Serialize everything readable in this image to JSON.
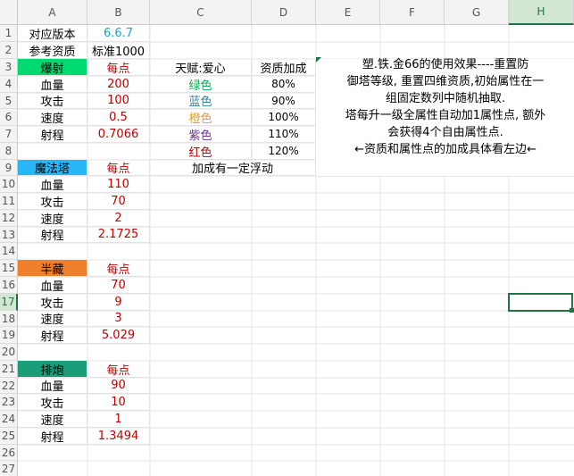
{
  "columns": [
    "A",
    "B",
    "C",
    "D",
    "E",
    "F",
    "G",
    "H"
  ],
  "selected_column": "H",
  "selected_row": "17",
  "rows": [
    "1",
    "2",
    "3",
    "4",
    "5",
    "6",
    "7",
    "8",
    "9",
    "10",
    "11",
    "12",
    "13",
    "14",
    "15",
    "16",
    "17",
    "18",
    "19",
    "20",
    "21",
    "22",
    "23",
    "24",
    "25",
    "26",
    "27"
  ],
  "meta": {
    "version_label": "对应版本",
    "version_value": "6.6.7",
    "aptitude_label": "参考资质",
    "aptitude_value": "标准1000"
  },
  "talent": {
    "header": "天赋:爱心",
    "bonus_header": "资质加成",
    "grades": [
      {
        "name": "绿色",
        "bonus": "80%",
        "color": "#00b050"
      },
      {
        "name": "蓝色",
        "bonus": "90%",
        "color": "#31859c"
      },
      {
        "name": "橙色",
        "bonus": "100%",
        "color": "#e0a030"
      },
      {
        "name": "紫色",
        "bonus": "110%",
        "color": "#7030a0"
      },
      {
        "name": "红色",
        "bonus": "120%",
        "color": "#c00000"
      }
    ],
    "float_note": "加成有一定浮动"
  },
  "towers": [
    {
      "name": "爆射",
      "per_point": "每点",
      "color": "#00d870",
      "stats": [
        [
          "血量",
          "200"
        ],
        [
          "攻击",
          "100"
        ],
        [
          "速度",
          "0.5"
        ],
        [
          "射程",
          "0.7066"
        ]
      ]
    },
    {
      "name": "魔法塔",
      "per_point": "每点",
      "color": "#29b6f6",
      "stats": [
        [
          "血量",
          "110"
        ],
        [
          "攻击",
          "70"
        ],
        [
          "速度",
          "2"
        ],
        [
          "射程",
          "2.1725"
        ]
      ]
    },
    {
      "name": "半藏",
      "per_point": "每点",
      "color": "#f07f2c",
      "stats": [
        [
          "血量",
          "70"
        ],
        [
          "攻击",
          "9"
        ],
        [
          "速度",
          "3"
        ],
        [
          "射程",
          "5.029"
        ]
      ]
    },
    {
      "name": "排炮",
      "per_point": "每点",
      "color": "#1a9e7a",
      "stats": [
        [
          "血量",
          "90"
        ],
        [
          "攻击",
          "10"
        ],
        [
          "速度",
          "1"
        ],
        [
          "射程",
          "1.3494"
        ]
      ]
    }
  ],
  "note": {
    "line1": "塑.铁.金66的使用效果----重置防",
    "line2": "御塔等级, 重置四维资质,初始属性在一",
    "line3": "组固定数列中随机抽取.",
    "line4": "塔每升一级全属性自动加1属性点, 额外",
    "line5": "会获得4个自由属性点.",
    "line6": "←资质和属性点的加成具体看左边←"
  },
  "colors": {
    "accent": "#217346",
    "value_red": "#c00000",
    "version_cyan": "#1aa5c4"
  }
}
